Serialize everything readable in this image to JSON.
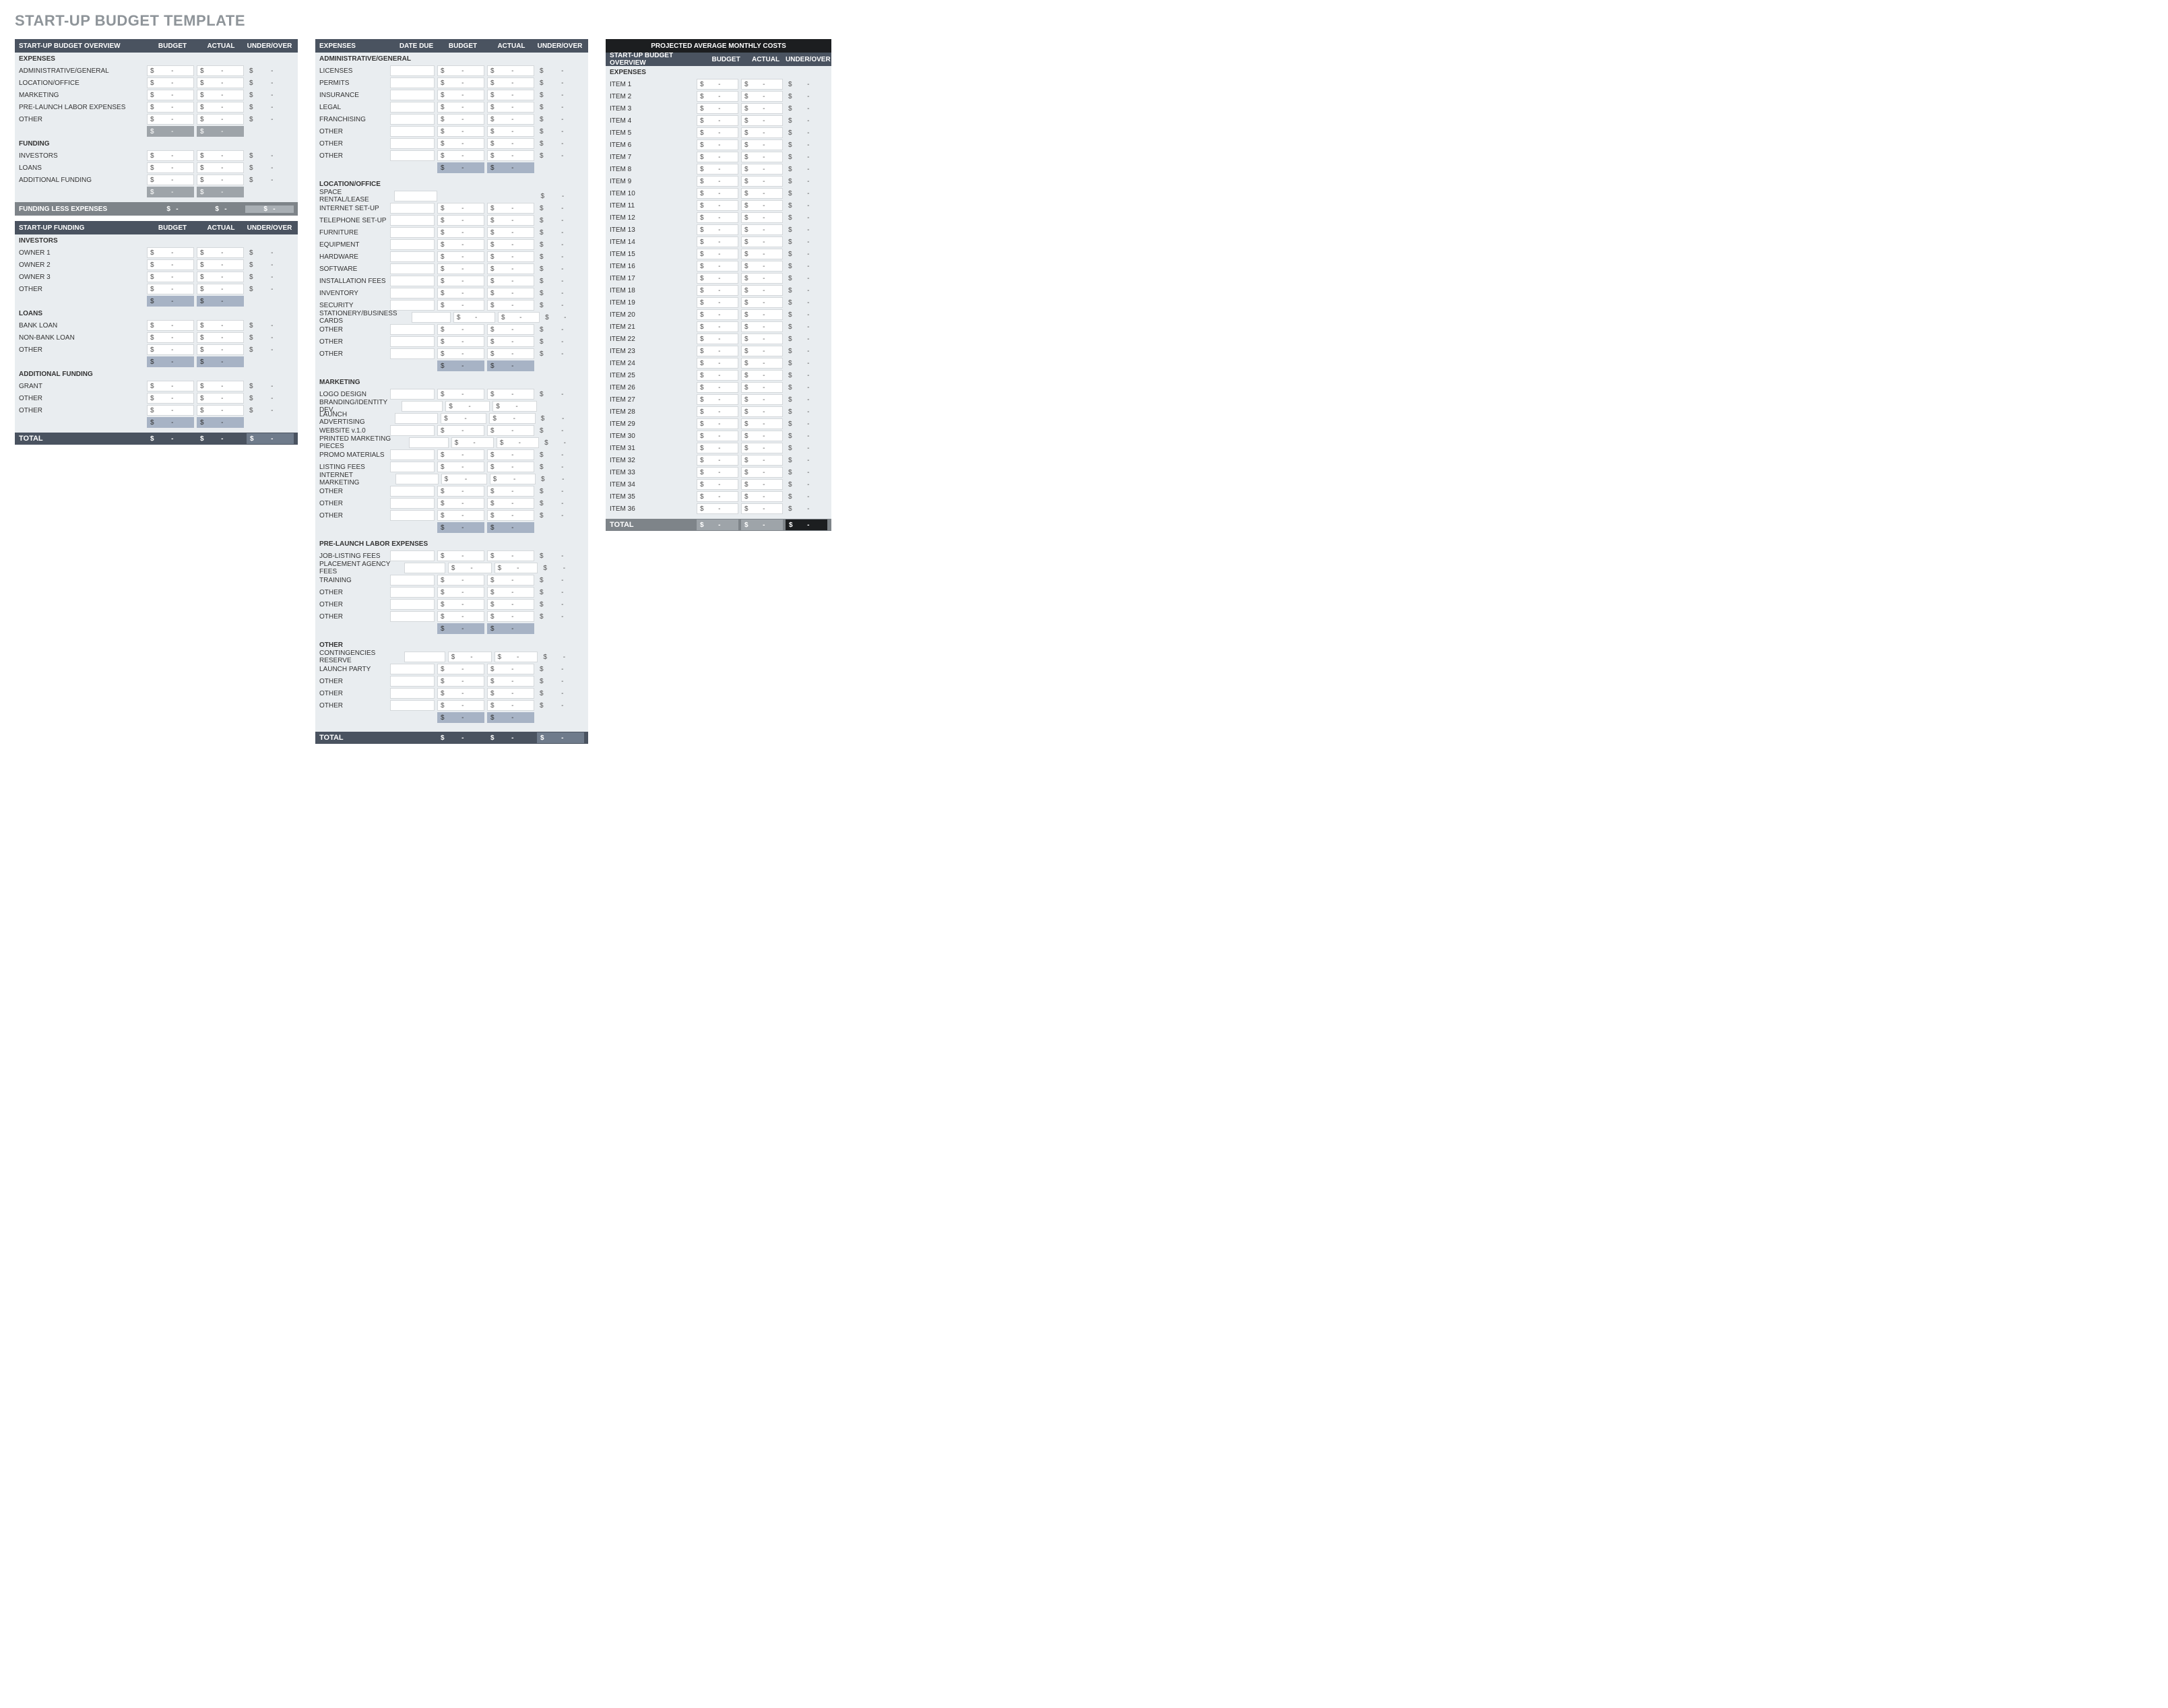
{
  "title": "START-UP BUDGET TEMPLATE",
  "currency": "$",
  "dash": "-",
  "col_headers": {
    "budget": "BUDGET",
    "actual": "ACTUAL",
    "underover": "UNDER/OVER",
    "datedue": "DATE DUE"
  },
  "overview": {
    "header": "START-UP BUDGET OVERVIEW",
    "expenses_label": "EXPENSES",
    "expenses": [
      {
        "label": "ADMINISTRATIVE/GENERAL"
      },
      {
        "label": "LOCATION/OFFICE"
      },
      {
        "label": "MARKETING"
      },
      {
        "label": "PRE-LAUNCH LABOR EXPENSES"
      },
      {
        "label": "OTHER"
      }
    ],
    "funding_label": "FUNDING",
    "funding": [
      {
        "label": "INVESTORS"
      },
      {
        "label": "LOANS"
      },
      {
        "label": "ADDITIONAL FUNDING"
      }
    ],
    "less_label": "FUNDING LESS EXPENSES"
  },
  "startup_funding": {
    "header": "START-UP FUNDING",
    "groups": [
      {
        "label": "INVESTORS",
        "rows": [
          "OWNER 1",
          "OWNER 2",
          "OWNER 3",
          "OTHER"
        ]
      },
      {
        "label": "LOANS",
        "rows": [
          "BANK LOAN",
          "NON-BANK LOAN",
          "OTHER"
        ]
      },
      {
        "label": "ADDITIONAL FUNDING",
        "rows": [
          "GRANT",
          "OTHER",
          "OTHER"
        ]
      }
    ],
    "total_label": "TOTAL"
  },
  "expenses_detail": {
    "header": "EXPENSES",
    "groups": [
      {
        "label": "ADMINISTRATIVE/GENERAL",
        "rows": [
          "LICENSES",
          "PERMITS",
          "INSURANCE",
          "LEGAL",
          "FRANCHISING",
          "OTHER",
          "OTHER",
          "OTHER"
        ]
      },
      {
        "label": "LOCATION/OFFICE",
        "rows": [
          "SPACE RENTAL/LEASE",
          "INTERNET SET-UP",
          "TELEPHONE SET-UP",
          "FURNITURE",
          "EQUIPMENT",
          "HARDWARE",
          "SOFTWARE",
          "INSTALLATION FEES",
          "INVENTORY",
          "SECURITY",
          "STATIONERY/BUSINESS CARDS",
          "OTHER",
          "OTHER",
          "OTHER"
        ],
        "blank_first_money": true
      },
      {
        "label": "MARKETING",
        "rows": [
          "LOGO DESIGN",
          "BRANDING/IDENTITY DEV.",
          "LAUNCH ADVERTISING",
          "WEBSITE v.1.0",
          "PRINTED MARKETING PIECES",
          "PROMO MATERIALS",
          "LISTING FEES",
          "INTERNET MARKETING",
          "OTHER",
          "OTHER",
          "OTHER"
        ],
        "blank_underover": [
          1
        ]
      },
      {
        "label": "PRE-LAUNCH LABOR EXPENSES",
        "rows": [
          "JOB-LISTING FEES",
          "PLACEMENT AGENCY FEES",
          "TRAINING",
          "OTHER",
          "OTHER",
          "OTHER"
        ]
      },
      {
        "label": "OTHER",
        "rows": [
          "CONTINGENCIES RESERVE",
          "LAUNCH PARTY",
          "OTHER",
          "OTHER",
          "OTHER"
        ]
      }
    ],
    "total_label": "TOTAL"
  },
  "monthly": {
    "title": "PROJECTED AVERAGE MONTHLY COSTS",
    "header": "START-UP BUDGET OVERVIEW",
    "expenses_label": "EXPENSES",
    "items": [
      "ITEM 1",
      "ITEM 2",
      "ITEM 3",
      "ITEM 4",
      "ITEM 5",
      "ITEM 6",
      "ITEM 7",
      "ITEM 8",
      "ITEM 9",
      "ITEM 10",
      "ITEM 11",
      "ITEM 12",
      "ITEM 13",
      "ITEM 14",
      "ITEM 15",
      "ITEM 16",
      "ITEM 17",
      "ITEM 18",
      "ITEM 19",
      "ITEM 20",
      "ITEM 21",
      "ITEM 22",
      "ITEM 23",
      "ITEM 24",
      "ITEM 25",
      "ITEM 26",
      "ITEM 27",
      "ITEM 28",
      "ITEM 29",
      "ITEM 30",
      "ITEM 31",
      "ITEM 32",
      "ITEM 33",
      "ITEM 34",
      "ITEM 35",
      "ITEM 36"
    ],
    "total_label": "TOTAL"
  }
}
